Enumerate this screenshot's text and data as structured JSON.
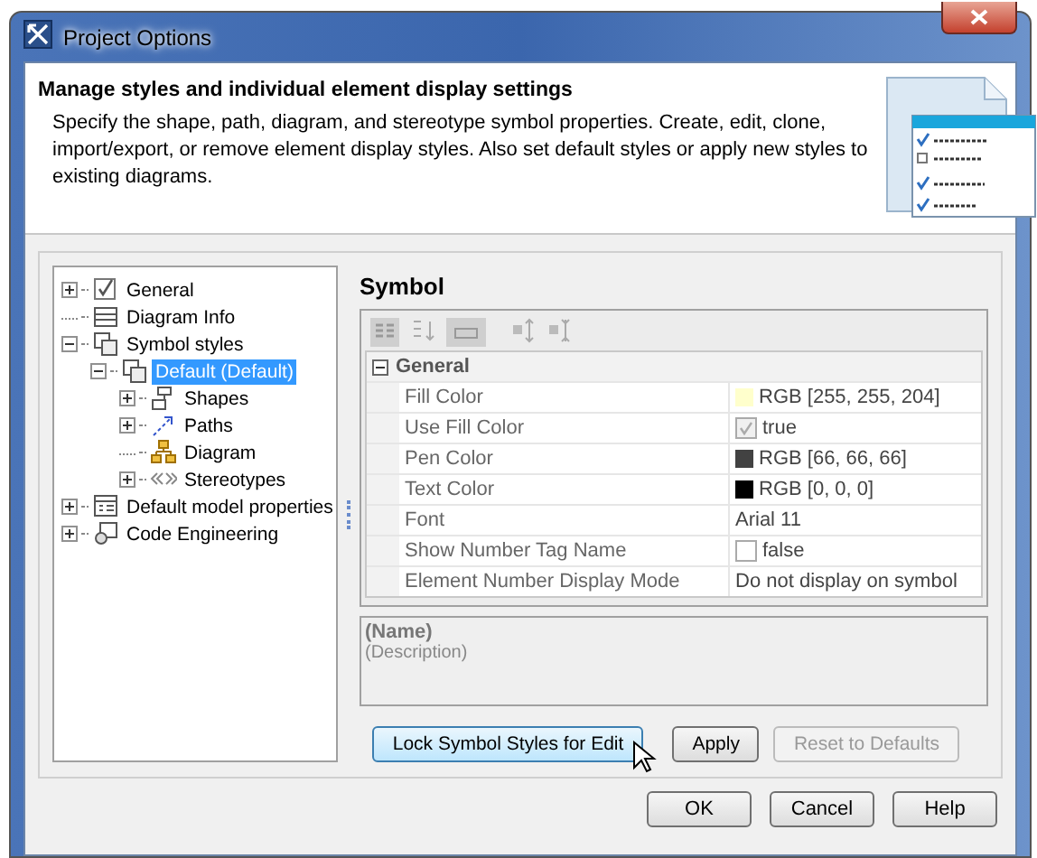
{
  "window": {
    "title": "Project Options"
  },
  "header": {
    "title": "Manage styles and individual element display settings",
    "description": "Specify the shape, path, diagram, and stereotype symbol properties. Create, edit, clone, import/export, or remove element display styles. Also set default styles or apply new styles to existing diagrams."
  },
  "tree": [
    {
      "label": "General",
      "kind": "branch",
      "expanded": false,
      "selected": false
    },
    {
      "label": "Diagram Info",
      "kind": "leaf",
      "selected": false
    },
    {
      "label": "Symbol styles",
      "kind": "branch",
      "expanded": true,
      "selected": false,
      "children": [
        {
          "label": "Default (Default)",
          "kind": "branch",
          "expanded": true,
          "selected": true,
          "children": [
            {
              "label": "Shapes",
              "kind": "branch",
              "expanded": false,
              "selected": false
            },
            {
              "label": "Paths",
              "kind": "branch",
              "expanded": false,
              "selected": false
            },
            {
              "label": "Diagram",
              "kind": "leaf",
              "selected": false
            },
            {
              "label": "Stereotypes",
              "kind": "branch",
              "expanded": false,
              "selected": false
            }
          ]
        }
      ]
    },
    {
      "label": "Default model properties",
      "kind": "branch",
      "expanded": false,
      "selected": false
    },
    {
      "label": "Code Engineering",
      "kind": "branch",
      "expanded": false,
      "selected": false
    }
  ],
  "panel": {
    "title": "Symbol",
    "section": {
      "title": "General",
      "expanded": true,
      "rows": [
        {
          "name": "Fill Color",
          "kind": "color",
          "value": "RGB [255, 255, 204]",
          "color": "#ffffcc"
        },
        {
          "name": "Use Fill Color",
          "kind": "check",
          "value": "true",
          "checked": true,
          "disabled": true
        },
        {
          "name": "Pen Color",
          "kind": "color",
          "value": "RGB [66, 66, 66]",
          "color": "#424242"
        },
        {
          "name": "Text Color",
          "kind": "color",
          "value": "RGB [0, 0, 0]",
          "color": "#000000"
        },
        {
          "name": "Font",
          "kind": "text",
          "value": "Arial 11"
        },
        {
          "name": "Show Number Tag Name",
          "kind": "check",
          "value": "false",
          "checked": false,
          "disabled": false
        },
        {
          "name": "Element Number Display Mode",
          "kind": "text",
          "value": "Do not display on symbol"
        }
      ]
    },
    "description": {
      "name": "(Name)",
      "text": "(Description)"
    },
    "buttons": [
      {
        "label": "Lock Symbol Styles for Edit",
        "hovered": true,
        "disabled": false
      },
      {
        "label": "Apply",
        "hovered": false,
        "disabled": false
      },
      {
        "label": "Reset to Defaults",
        "hovered": false,
        "disabled": true
      }
    ]
  },
  "buttons": [
    {
      "label": "OK"
    },
    {
      "label": "Cancel"
    },
    {
      "label": "Help"
    }
  ]
}
